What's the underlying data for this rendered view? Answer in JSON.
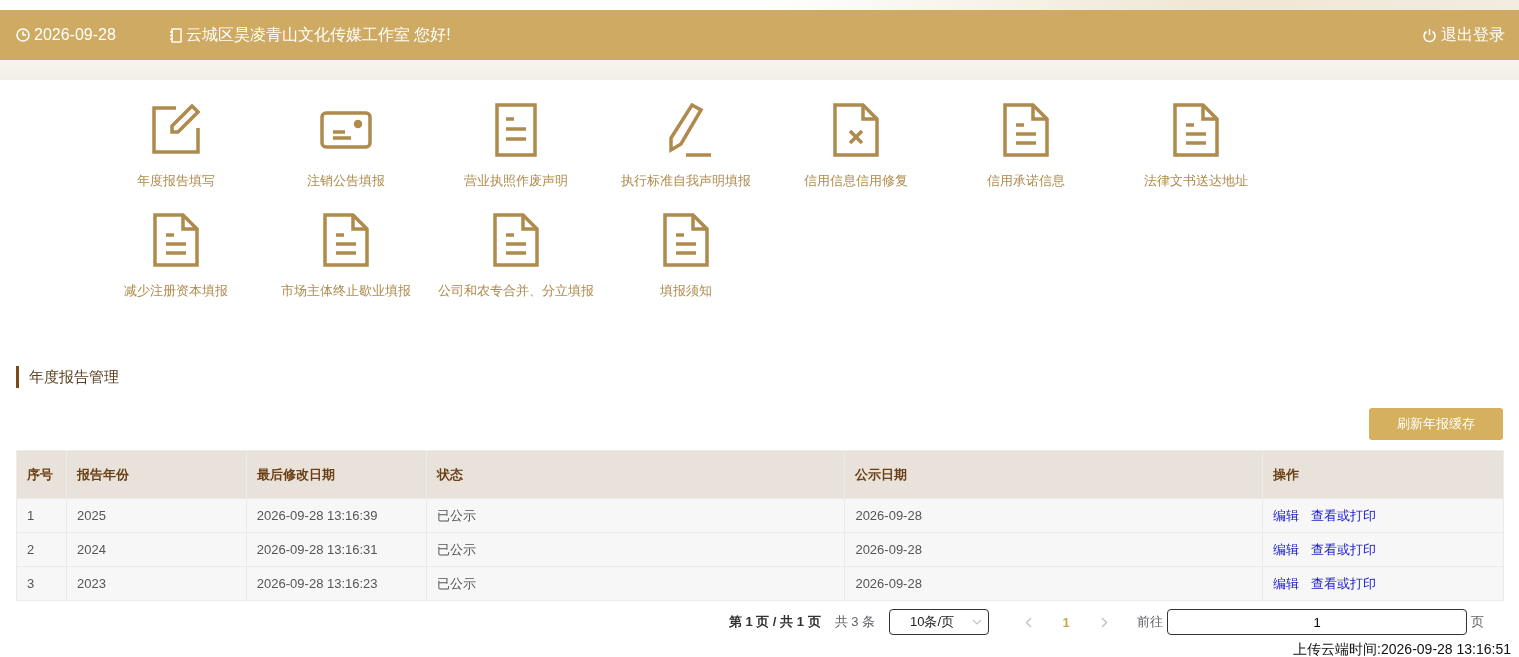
{
  "header": {
    "date": "2026-09-28",
    "greeting": "云城区昊凌青山文化传媒工作室 您好!",
    "logout": "退出登录"
  },
  "shortcuts": [
    {
      "kind": "edit",
      "label": "年度报告填写"
    },
    {
      "kind": "card",
      "label": "注销公告填报"
    },
    {
      "kind": "doc",
      "label": "营业执照作废声明"
    },
    {
      "kind": "pencil",
      "label": "执行标准自我声明填报"
    },
    {
      "kind": "doc-x",
      "label": "信用信息信用修复"
    },
    {
      "kind": "doc-lines",
      "label": "信用承诺信息"
    },
    {
      "kind": "doc-lines",
      "label": "法律文书送达地址"
    },
    {
      "kind": "doc-lines",
      "label": "减少注册资本填报"
    },
    {
      "kind": "doc-lines",
      "label": "市场主体终止歇业填报"
    },
    {
      "kind": "doc-lines",
      "label": "公司和农专合并、分立填报"
    },
    {
      "kind": "doc-lines",
      "label": "填报须知"
    }
  ],
  "section": {
    "title": "年度报告管理",
    "refresh_button": "刷新年报缓存"
  },
  "table": {
    "columns": [
      "序号",
      "报告年份",
      "最后修改日期",
      "状态",
      "公示日期",
      "操作"
    ],
    "rows": [
      {
        "cells": [
          "1",
          "2025",
          "2026-09-28 13:16:39",
          "已公示",
          "2026-09-28"
        ],
        "actions": [
          "编辑",
          "查看或打印"
        ]
      },
      {
        "cells": [
          "2",
          "2024",
          "2026-09-28 13:16:31",
          "已公示",
          "2026-09-28"
        ],
        "actions": [
          "编辑",
          "查看或打印"
        ]
      },
      {
        "cells": [
          "3",
          "2023",
          "2026-09-28 13:16:23",
          "已公示",
          "2026-09-28"
        ],
        "actions": [
          "编辑",
          "查看或打印"
        ]
      }
    ]
  },
  "pagination": {
    "summary": "第 1 页 / 共 1 页",
    "total": "共 3 条",
    "page_size": "10条/页",
    "pages": [
      {
        "label": "1",
        "selected": true
      }
    ],
    "goto_label": "前往",
    "goto_value": "1",
    "goto_suffix": "页"
  },
  "upload_time": "上传云端时间:2026-09-28 13:16:51"
}
